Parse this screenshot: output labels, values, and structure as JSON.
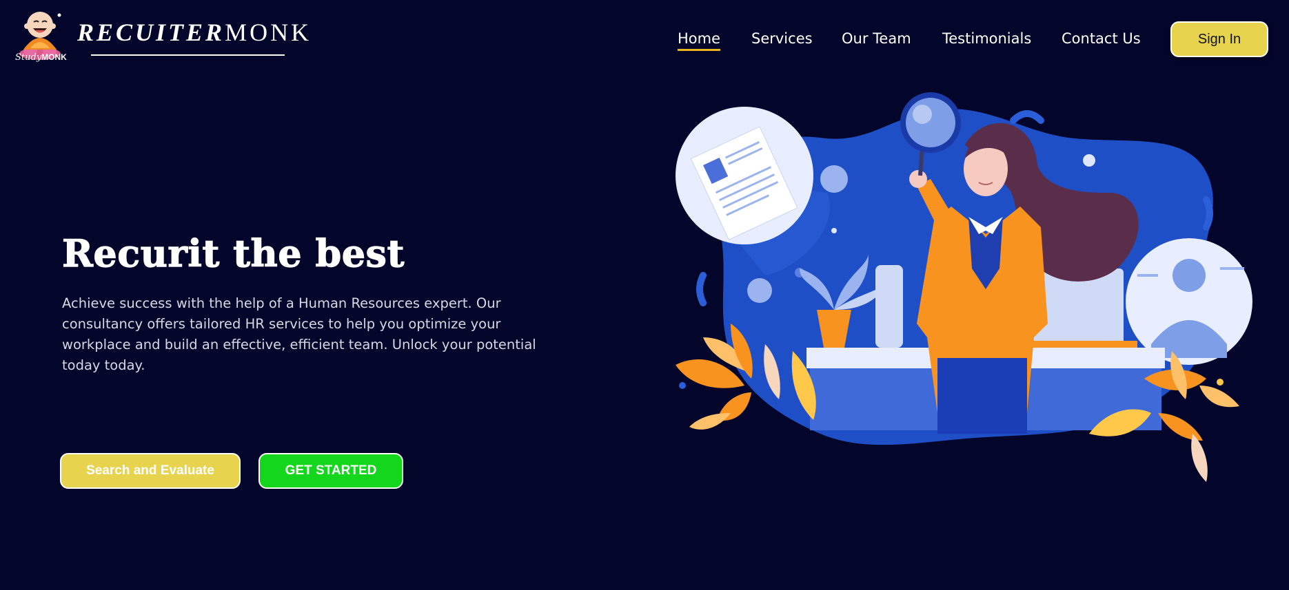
{
  "brand": {
    "logo_word_part1": "RECUITER",
    "logo_word_part2": "MONK",
    "logo_sub_part1": "Study",
    "logo_sub_part2": "MONK"
  },
  "nav": {
    "items": [
      {
        "label": "Home",
        "active": true
      },
      {
        "label": "Services",
        "active": false
      },
      {
        "label": "Our Team",
        "active": false
      },
      {
        "label": "Testimonials",
        "active": false
      },
      {
        "label": "Contact Us",
        "active": false
      }
    ],
    "signin_label": "Sign In"
  },
  "hero": {
    "title": "Recurit the best",
    "description": "Achieve success with the help of a Human Resources expert. Our consultancy offers tailored HR services to help you optimize your workplace and build an effective, efficient team. Unlock your potential today today.",
    "search_button": "Search and Evaluate",
    "start_button": "GET STARTED"
  },
  "colors": {
    "background": "#03062a",
    "accent_yellow": "#e8d34e",
    "accent_green": "#14d61c",
    "active_underline": "#e9b61e",
    "illustration_blue": "#1f4fc7",
    "illustration_orange": "#f7931e"
  },
  "icons": {
    "logo_mascot": "monk-mascot-icon",
    "illustration": "recruiter-magnifier-illustration"
  }
}
